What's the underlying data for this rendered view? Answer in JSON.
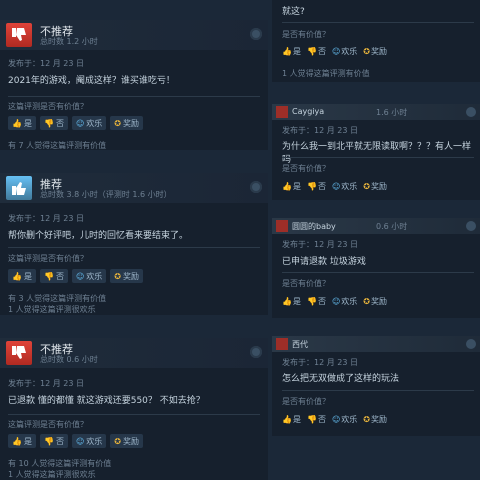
{
  "labels": {
    "posted_prefix": "发布于：",
    "helpful_q": "这篇评测是否有价值？",
    "helpful_q_short": "是否有价值？",
    "yes": "是",
    "no": "否",
    "funny": "欢乐",
    "award": "奖励"
  },
  "reviews_left": [
    {
      "recommend": "不推荐",
      "hours": "总时数 1.2 小时",
      "posted": "发布于：12 月 23 日",
      "text": "2021年的游戏，阉成这样？谁买谁吃亏！",
      "found": [
        "有 7 人觉得这篇评测有价值"
      ]
    },
    {
      "recommend": "推荐",
      "hours": "总时数 3.8 小时（评测时 1.6 小时）",
      "posted": "发布于：12 月 23 日",
      "text": "帮你删个好评吧，儿时的回忆看来要结束了。",
      "found": [
        "有 3 人觉得这篇评测有价值",
        "1 人觉得这篇评测很欢乐"
      ]
    },
    {
      "recommend": "不推荐",
      "hours": "总时数 0.6 小时",
      "posted": "发布于：12 月 23 日",
      "text": "已退款 懂的都懂 就这游戏还要550？ 不如去抢？",
      "found": [
        "有 10 人觉得这篇评测有价值",
        "1 人觉得这篇评测很欢乐"
      ]
    }
  ],
  "replies_right": [
    {
      "name": "",
      "hours": "",
      "posted": "",
      "text": "就这?",
      "found": "1 人觉得这篇评测有价值"
    },
    {
      "name": "Caygiya",
      "hours": "1.6 小时",
      "posted": "发布于：12 月 23 日",
      "text": "为什么我一到北平就无限读取啊？？？有人一样吗",
      "found": ""
    },
    {
      "name": "圆圆的baby",
      "hours": "0.6 小时",
      "posted": "发布于：12 月 23 日",
      "text": "已申请退款 垃圾游戏",
      "found": ""
    },
    {
      "name": "西代",
      "hours": "",
      "posted": "发布于：12 月 23 日",
      "text": "怎么把无双做成了这样的玩法",
      "found": ""
    }
  ]
}
